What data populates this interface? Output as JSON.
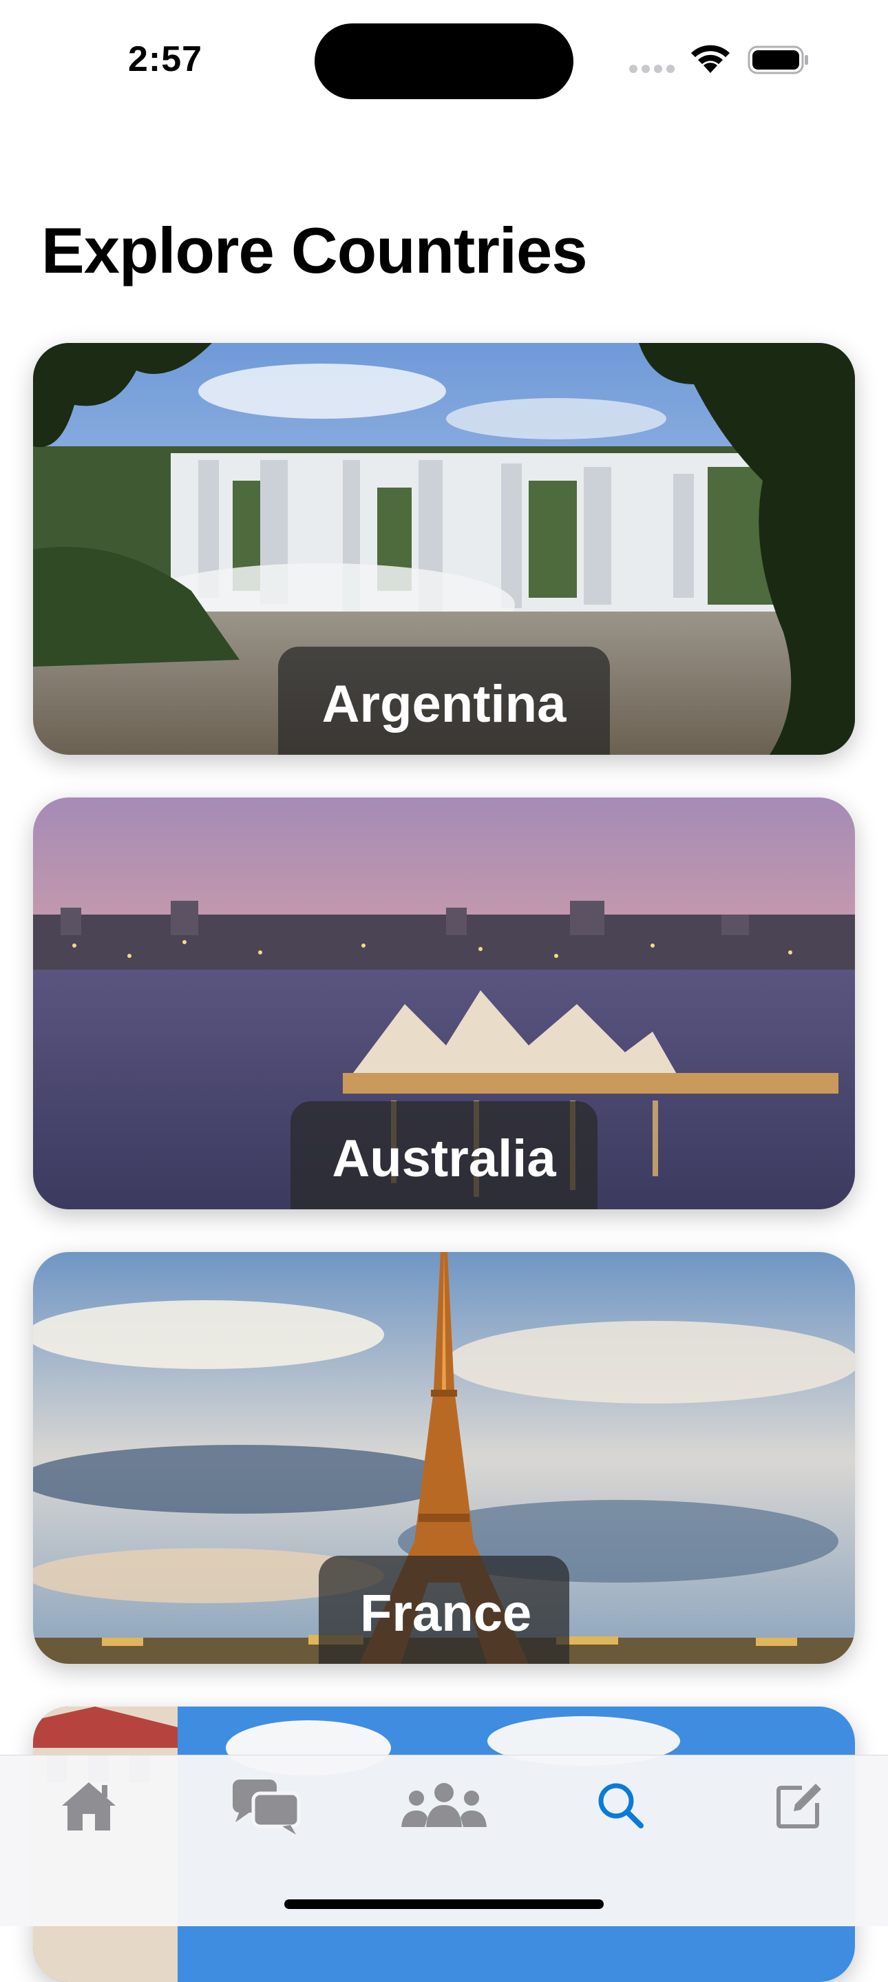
{
  "status_bar": {
    "time": "2:57"
  },
  "title": "Explore Countries",
  "countries": [
    {
      "name": "Argentina"
    },
    {
      "name": "Australia"
    },
    {
      "name": "France"
    },
    {
      "name": ""
    }
  ],
  "tab_bar": {
    "tabs": [
      {
        "icon": "home-icon",
        "selected": false
      },
      {
        "icon": "chat-bubbles-icon",
        "selected": false
      },
      {
        "icon": "people-icon",
        "selected": false
      },
      {
        "icon": "search-icon",
        "selected": true
      },
      {
        "icon": "compose-icon",
        "selected": false
      }
    ],
    "active_color": "#0a7bd8",
    "inactive_color": "#8e8e93"
  }
}
